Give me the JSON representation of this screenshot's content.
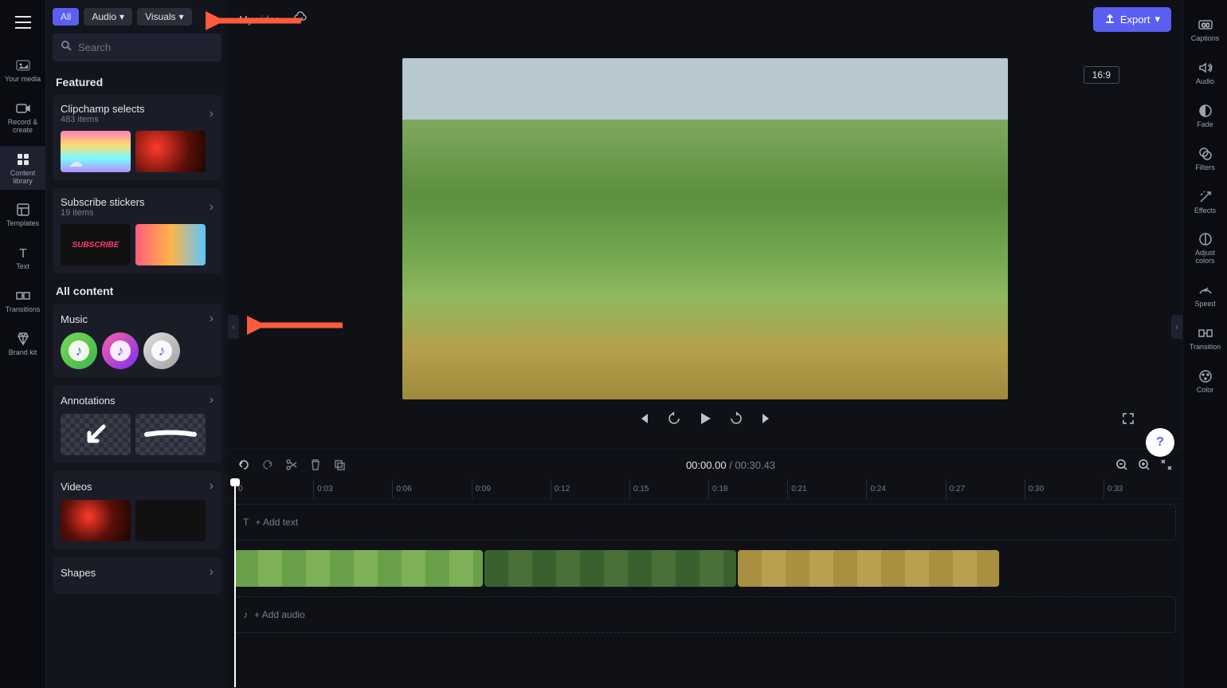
{
  "leftRail": {
    "items": [
      {
        "label": "Your media"
      },
      {
        "label": "Record & create"
      },
      {
        "label": "Content library"
      },
      {
        "label": "Templates"
      },
      {
        "label": "Text"
      },
      {
        "label": "Transitions"
      },
      {
        "label": "Brand kit"
      }
    ]
  },
  "sidebar": {
    "filters": {
      "all": "All",
      "audio": "Audio",
      "visuals": "Visuals"
    },
    "searchPlaceholder": "Search",
    "featured": {
      "title": "Featured",
      "collections": [
        {
          "title": "Clipchamp selects",
          "sub": "483 items"
        },
        {
          "title": "Subscribe stickers",
          "sub": "19 items"
        }
      ]
    },
    "allContent": {
      "title": "All content",
      "groups": [
        {
          "title": "Music"
        },
        {
          "title": "Annotations"
        },
        {
          "title": "Videos"
        },
        {
          "title": "Shapes"
        }
      ]
    }
  },
  "topbar": {
    "projectName": "My video",
    "export": "Export"
  },
  "preview": {
    "aspect": "16:9"
  },
  "timeline": {
    "current": "00:00.00",
    "duration": "00:30.43",
    "addText": "+ Add text",
    "addAudio": "+ Add audio",
    "ticks": [
      "0",
      "0:03",
      "0:06",
      "0:09",
      "0:12",
      "0:15",
      "0:18",
      "0:21",
      "0:24",
      "0:27",
      "0:30",
      "0:33"
    ]
  },
  "rightRail": {
    "items": [
      {
        "label": "Captions"
      },
      {
        "label": "Audio"
      },
      {
        "label": "Fade"
      },
      {
        "label": "Filters"
      },
      {
        "label": "Effects"
      },
      {
        "label": "Adjust colors"
      },
      {
        "label": "Speed"
      },
      {
        "label": "Transition"
      },
      {
        "label": "Color"
      }
    ]
  },
  "help": "?"
}
